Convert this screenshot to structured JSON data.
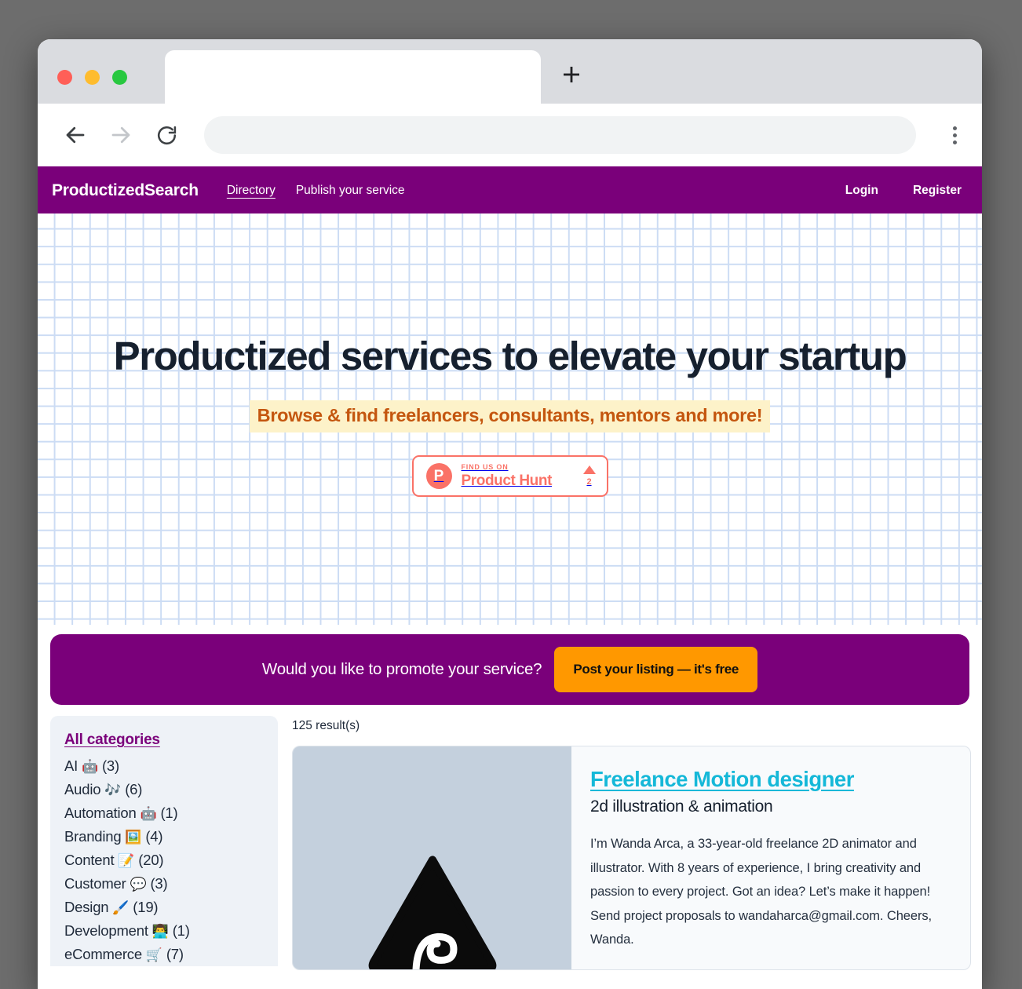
{
  "browser": {
    "tab_title": "",
    "new_tab_label": "+",
    "back_icon": "arrow-left-icon",
    "forward_icon": "arrow-right-icon",
    "reload_icon": "reload-icon",
    "menu_icon": "kebab-menu-icon",
    "address_value": "",
    "address_placeholder": ""
  },
  "site": {
    "brand": "ProductizedSearch",
    "nav_left": [
      {
        "label": "Directory",
        "active": true
      },
      {
        "label": "Publish your service",
        "active": false
      }
    ],
    "nav_right": [
      {
        "label": "Login"
      },
      {
        "label": "Register"
      }
    ],
    "accent_purple": "#7a007a"
  },
  "hero": {
    "title": "Productized services to elevate your startup",
    "subtitle": "Browse & find freelancers, consultants, mentors and more!",
    "subtitle_bg": "#fdf2c9",
    "subtitle_color": "#c4560f",
    "product_hunt": {
      "kicker": "FIND US ON",
      "name": "Product Hunt",
      "logo_letter": "P",
      "vote_count": "2",
      "color": "#fa7267"
    }
  },
  "promo": {
    "text": "Would you like to promote your service?",
    "cta_label": "Post your listing — it's free",
    "cta_color": "#ff9800"
  },
  "sidebar": {
    "all_label": "All categories",
    "categories": [
      {
        "label": "AI",
        "emoji": "🤖",
        "count": "(3)"
      },
      {
        "label": "Audio",
        "emoji": "🎶",
        "count": "(6)"
      },
      {
        "label": "Automation",
        "emoji": "🤖",
        "count": "(1)"
      },
      {
        "label": "Branding",
        "emoji": "🖼️",
        "count": "(4)"
      },
      {
        "label": "Content",
        "emoji": "📝",
        "count": "(20)"
      },
      {
        "label": "Customer",
        "emoji": "💬",
        "count": "(3)"
      },
      {
        "label": "Design",
        "emoji": "🖌️",
        "count": "(19)"
      },
      {
        "label": "Development",
        "emoji": "👨‍💻",
        "count": "(1)"
      },
      {
        "label": "eCommerce",
        "emoji": "🛒",
        "count": "(7)"
      }
    ]
  },
  "results": {
    "count_label": "125 result(s)",
    "items": [
      {
        "title": "Freelance Motion designer",
        "subtitle": "2d illustration & animation",
        "description": "I’m Wanda Arca, a 33-year-old freelance 2D animator and illustrator. With 8 years of experience, I bring creativity and passion to every project. Got an idea? Let’s make it happen! Send project proposals to wandaharca@gmail.com. Cheers, Wanda.",
        "thumb_bg": "#c4d0dd",
        "thumb_icon": "triangle-swirl-logo"
      }
    ]
  }
}
